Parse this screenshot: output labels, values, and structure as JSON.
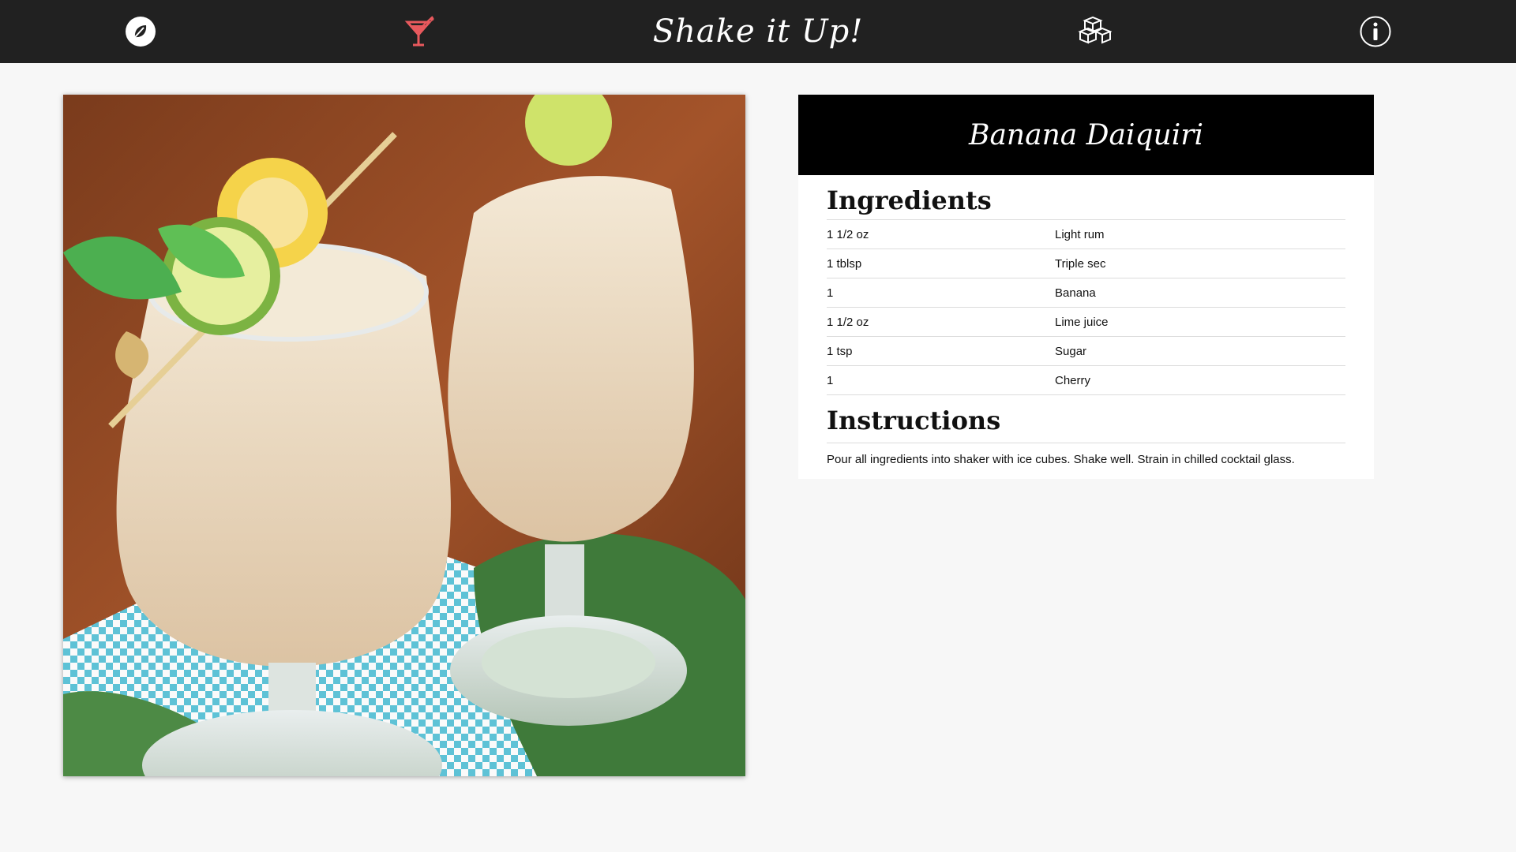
{
  "app": {
    "brand": "Shake it Up!",
    "nav_icons": [
      "compass-leaf-icon",
      "cocktail-glass-icon",
      "ice-cubes-icon",
      "info-icon"
    ],
    "accent_color": "#e8595d"
  },
  "recipe": {
    "name": "Banana Daiquiri",
    "ingredients_heading": "Ingredients",
    "ingredients": [
      {
        "amount": "1 1/2 oz",
        "name": "Light rum"
      },
      {
        "amount": "1 tblsp",
        "name": "Triple sec"
      },
      {
        "amount": "1",
        "name": "Banana"
      },
      {
        "amount": "1 1/2 oz",
        "name": "Lime juice"
      },
      {
        "amount": "1 tsp",
        "name": "Sugar"
      },
      {
        "amount": "1",
        "name": "Cherry"
      }
    ],
    "instructions_heading": "Instructions",
    "instructions": "Pour all ingredients into shaker with ice cubes. Shake well. Strain in chilled cocktail glass."
  }
}
